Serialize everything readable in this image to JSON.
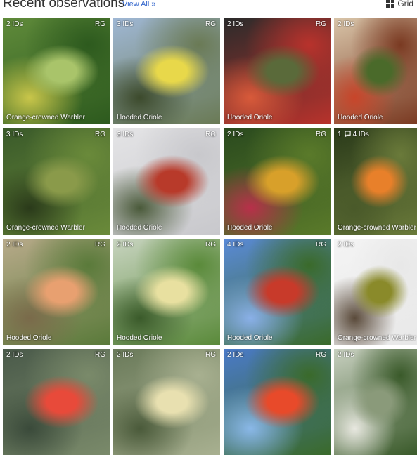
{
  "header": {
    "title": "Recent observations",
    "view_all": "View All »",
    "grid_label": "Grid"
  },
  "tiles": [
    {
      "ids": "2 IDs",
      "grade": "RG",
      "species": "Orange-crowned Warbler",
      "palette": [
        "#5f8a3a",
        "#2d5a1e",
        "#a9c46a",
        "#c9c64a"
      ]
    },
    {
      "ids": "3 IDs",
      "grade": "RG",
      "species": "Hooded Oriole",
      "palette": [
        "#9fb7d4",
        "#6a7a55",
        "#e8d84a",
        "#3c4a2c"
      ]
    },
    {
      "ids": "2 IDs",
      "grade": "RG",
      "species": "Hooded Oriole",
      "palette": [
        "#2b2b2b",
        "#b8322c",
        "#5a6a3a",
        "#d85a3a"
      ]
    },
    {
      "ids": "2 IDs",
      "grade": "",
      "species": "Hooded Oriole",
      "palette": [
        "#d8c4a8",
        "#7a3a22",
        "#4a6a2a",
        "#c8452a"
      ]
    },
    {
      "ids": "3 IDs",
      "grade": "RG",
      "species": "Orange-crowned Warbler",
      "palette": [
        "#3a5a2a",
        "#6a8a3a",
        "#8a9a4a",
        "#2a3a1a"
      ]
    },
    {
      "ids": "3 IDs",
      "grade": "RG",
      "species": "Hooded Oriole",
      "palette": [
        "#e4e4e6",
        "#c8c8cc",
        "#b83a2a",
        "#4a5a3a"
      ]
    },
    {
      "ids": "2 IDs",
      "grade": "RG",
      "species": "Hooded Oriole",
      "palette": [
        "#2a4a1e",
        "#5a7a2a",
        "#d8a02a",
        "#b8304a"
      ]
    },
    {
      "ids": "4 IDs",
      "comments": "1",
      "grade": "",
      "species": "Orange-crowned Warbler",
      "palette": [
        "#2a3a1a",
        "#6a7a3a",
        "#e8802a",
        "#4a5a2a"
      ]
    },
    {
      "ids": "2 IDs",
      "grade": "RG",
      "species": "Hooded Oriole",
      "palette": [
        "#b8aa8a",
        "#5a7a3a",
        "#e8a070",
        "#7a6a4a"
      ]
    },
    {
      "ids": "2 IDs",
      "grade": "RG",
      "species": "Hooded Oriole",
      "palette": [
        "#c8d4c0",
        "#5a8a3a",
        "#e8e0a0",
        "#3a5a2a"
      ]
    },
    {
      "ids": "4 IDs",
      "grade": "RG",
      "species": "Hooded Oriole",
      "palette": [
        "#5a8ad8",
        "#3a6a2a",
        "#c83a2a",
        "#8ab0e8"
      ]
    },
    {
      "ids": "2 IDs",
      "grade": "",
      "species": "Orange-crowned Warbler",
      "palette": [
        "#f4f4f4",
        "#e8e8e8",
        "#8a8a2a",
        "#5a4a3a"
      ]
    },
    {
      "ids": "2 IDs",
      "grade": "RG",
      "species": "",
      "palette": [
        "#4a5a4a",
        "#7a8a6a",
        "#e84a3a",
        "#3a4a3a"
      ]
    },
    {
      "ids": "2 IDs",
      "grade": "RG",
      "species": "",
      "palette": [
        "#6a7a5a",
        "#a8b090",
        "#e8e0b0",
        "#4a5a3a"
      ]
    },
    {
      "ids": "2 IDs",
      "grade": "RG",
      "species": "",
      "palette": [
        "#4a7ac8",
        "#3a6a2a",
        "#e84a2a",
        "#8ab8e8"
      ]
    },
    {
      "ids": "2 IDs",
      "grade": "",
      "species": "",
      "palette": [
        "#c8d0c0",
        "#3a5a2a",
        "#8a9a7a",
        "#e8e8e0"
      ]
    }
  ]
}
